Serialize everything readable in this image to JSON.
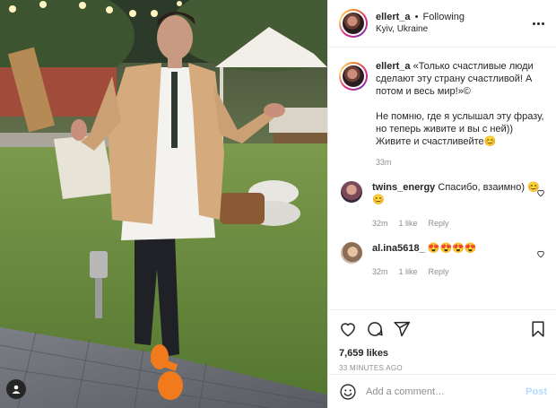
{
  "header": {
    "username": "ellert_a",
    "separator": "•",
    "follow_label": "Following",
    "location": "Kyiv, Ukraine"
  },
  "caption": {
    "username": "ellert_a",
    "text": "«Только счастливые люди сделают эту страну счастливой! А потом и весь мир!»©\n\nНе помню, где я услышал эту фразу, но теперь живите и вы с ней)) Живите и счастливейте😊",
    "time": "33m"
  },
  "comments": [
    {
      "username": "twins_energy",
      "text": "Спасибо, взаимно) 😊😊",
      "time": "32m",
      "likes": "1 like",
      "reply": "Reply"
    },
    {
      "username": "al.ina5618_",
      "text": "😍😍😍😍",
      "time": "32m",
      "likes": "1 like",
      "reply": "Reply"
    }
  ],
  "stats": {
    "likes": "7,659 likes",
    "time_ago": "33 MINUTES AGO"
  },
  "composer": {
    "placeholder": "Add a comment…",
    "post_label": "Post"
  },
  "icons": {
    "more": "more-options-icon",
    "like": "heart-icon",
    "comment": "comment-icon",
    "share": "share-icon",
    "save": "bookmark-icon",
    "emoji": "emoji-icon",
    "tag": "user-tag-icon"
  },
  "colors": {
    "text": "#262626",
    "muted": "#8e8e8e",
    "border": "#efefef",
    "post_disabled": "#b3dbff"
  }
}
